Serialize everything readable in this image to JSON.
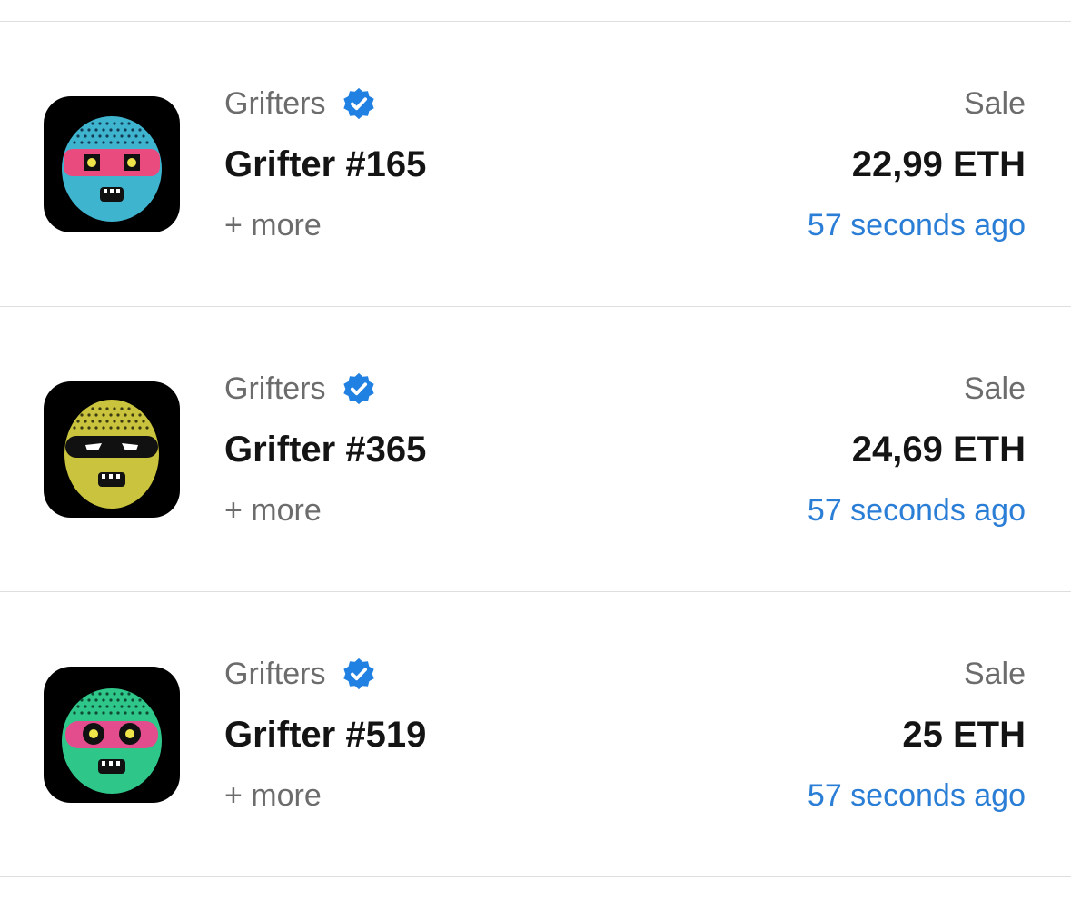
{
  "colors": {
    "accent_blue": "#2a7ed6",
    "verified_blue": "#2081e2",
    "divider": "#dedede",
    "secondary_text": "#6c6c6c",
    "primary_text": "#141414"
  },
  "items": [
    {
      "collection": "Grifters",
      "verified_icon": "verified-check-icon",
      "name": "Grifter #165",
      "more": "+ more",
      "event": "Sale",
      "price": "22,99 ETH",
      "time": "57 seconds ago",
      "avatar": {
        "face_color": "#3fb4cf",
        "mask_color": "#e94b7f",
        "dots_color": "#123c55"
      }
    },
    {
      "collection": "Grifters",
      "verified_icon": "verified-check-icon",
      "name": "Grifter #365",
      "more": "+ more",
      "event": "Sale",
      "price": "24,69 ETH",
      "time": "57 seconds ago",
      "avatar": {
        "face_color": "#c9c33d",
        "mask_color": "#111111",
        "dots_color": "#3d3b12"
      }
    },
    {
      "collection": "Grifters",
      "verified_icon": "verified-check-icon",
      "name": "Grifter #519",
      "more": "+ more",
      "event": "Sale",
      "price": "25 ETH",
      "time": "57 seconds ago",
      "avatar": {
        "face_color": "#2fc68a",
        "mask_color": "#e34d8d",
        "dots_color": "#0f4a32"
      }
    }
  ]
}
